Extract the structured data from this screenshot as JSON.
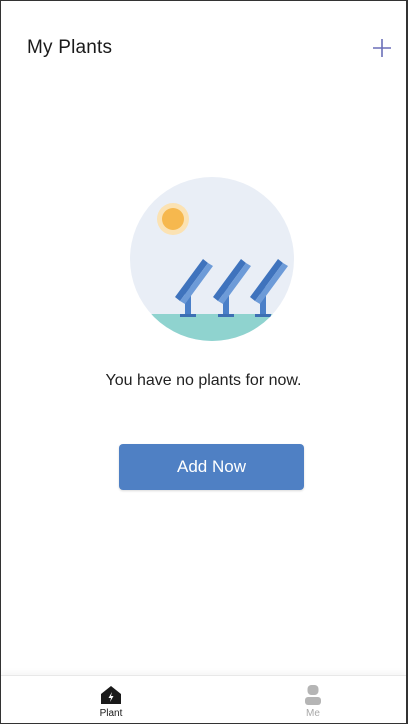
{
  "header": {
    "title": "My Plants",
    "add_icon": "plus-icon"
  },
  "empty_state": {
    "illustration": "solar-panels-illustration",
    "message": "You have no plants for now.",
    "button_label": "Add Now"
  },
  "tabbar": {
    "tabs": [
      {
        "label": "Plant",
        "icon": "house-bolt-icon",
        "active": true
      },
      {
        "label": "Me",
        "icon": "user-icon",
        "active": false
      }
    ]
  },
  "colors": {
    "accent": "#4f80c4",
    "illustration_bg": "#e9eef6",
    "sun": "#f6b84e",
    "ground": "#8fd3cf",
    "panel": "#4a7fc8",
    "tab_active": "#1a1a1a",
    "tab_inactive": "#a8a8a8"
  }
}
